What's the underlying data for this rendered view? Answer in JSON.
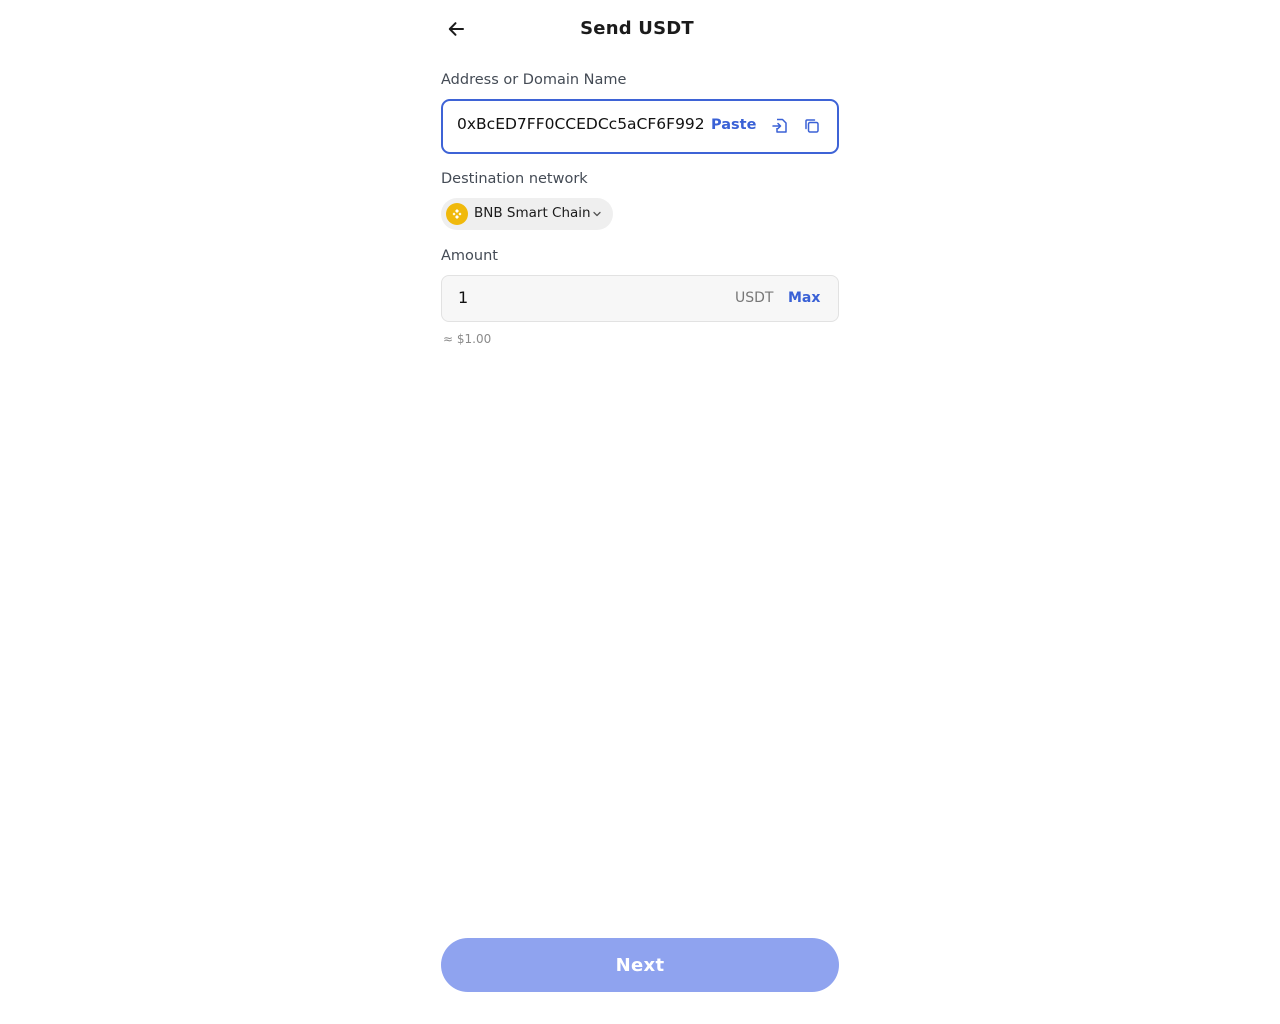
{
  "header": {
    "title": "Send USDT",
    "back_icon": "arrow-left-icon"
  },
  "address": {
    "label": "Address or Domain Name",
    "value": "0xBcED7FF0CCEDCc5aCF6F992",
    "paste_label": "Paste",
    "paste_icon": "paste-file-icon",
    "copy_icon": "copy-icon",
    "border_color": "#3e63d6"
  },
  "network": {
    "label": "Destination network",
    "selected": "BNB Smart Chain",
    "logo_icon": "bnb-logo-icon",
    "logo_color": "#f0b90b"
  },
  "amount": {
    "label": "Amount",
    "value": "1",
    "unit": "USDT",
    "max_label": "Max",
    "fiat_estimate": "≈ $1.00"
  },
  "footer": {
    "next_label": "Next",
    "next_color": "#8fa3ef"
  },
  "colors": {
    "accent": "#3a61d6"
  }
}
